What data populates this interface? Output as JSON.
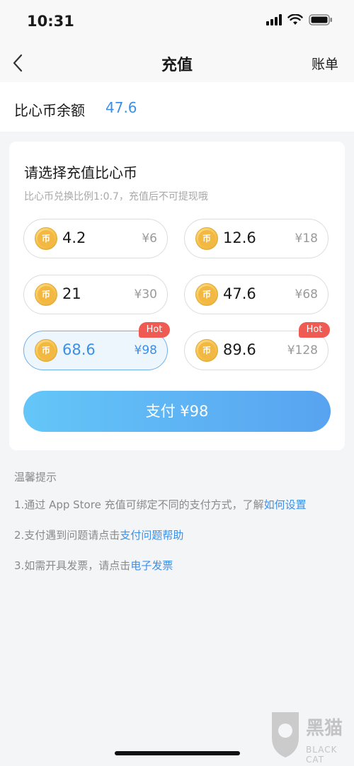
{
  "status_bar": {
    "time": "10:31"
  },
  "nav": {
    "title": "充值",
    "right": "账单"
  },
  "balance": {
    "label": "比心币余额",
    "value": "47.6"
  },
  "card": {
    "title": "请选择充值比心币",
    "subtitle": "比心币兑换比例1:0.7，充值后不可提现哦",
    "coin_glyph": "币",
    "options": [
      {
        "amount": "4.2",
        "price": "¥6"
      },
      {
        "amount": "12.6",
        "price": "¥18"
      },
      {
        "amount": "21",
        "price": "¥30"
      },
      {
        "amount": "47.6",
        "price": "¥68"
      },
      {
        "amount": "68.6",
        "price": "¥98",
        "badge": "Hot",
        "selected": true
      },
      {
        "amount": "89.6",
        "price": "¥128",
        "badge": "Hot"
      }
    ],
    "pay_button": "支付 ¥98"
  },
  "tips": {
    "title": "温馨提示",
    "items": [
      {
        "text": "1.通过 App Store 充值可绑定不同的支付方式，了解",
        "link": "如何设置"
      },
      {
        "text": "2.支付遇到问题请点击",
        "link": "支付问题帮助"
      },
      {
        "text": "3.如需开具发票，请点击",
        "link": "电子发票"
      }
    ]
  },
  "watermark": {
    "text": "黑猫",
    "sub": "BLACK CAT"
  },
  "colors": {
    "accent": "#3c8fe6",
    "hot": "#ef5b52",
    "pay_gradient_start": "#64c6f8",
    "pay_gradient_end": "#58a3f0"
  }
}
